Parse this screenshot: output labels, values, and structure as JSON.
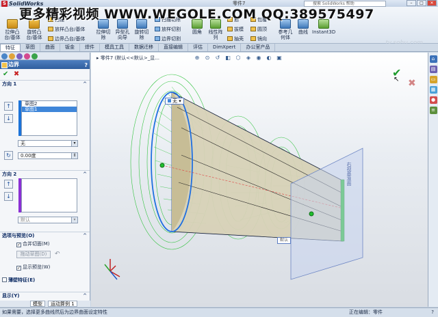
{
  "app": {
    "name": "SolidWorks",
    "document_title": "零件7",
    "search_placeholder": "搜索 SolidWorks 帮助"
  },
  "watermark": {
    "cn": "更多精彩视频",
    "url": "WWW.WEGOLE.COM",
    "qq": "QQ:389575497"
  },
  "corner_mark": "tv.sohu.com",
  "ribbon": {
    "buttons": [
      "拉伸凸台/基体",
      "旋转凸台/基体",
      "拉伸切除",
      "异型孔向导",
      "旋转切除",
      "圆角",
      "线性阵列",
      "拔模",
      "参考几何体",
      "曲线",
      "Instant3D"
    ],
    "small": [
      "扫描",
      "放样凸台/基体",
      "边界凸台/基体",
      "扫描切除",
      "放样切割",
      "边界切割",
      "筋",
      "抽壳",
      "包覆",
      "圆顶",
      "镜向"
    ]
  },
  "tabs": [
    "特征",
    "草图",
    "曲面",
    "钣金",
    "焊件",
    "模具工具",
    "数据迁移",
    "直接编辑",
    "评估",
    "DimXpert",
    "办公室产品"
  ],
  "property_manager": {
    "title": "边界",
    "direction1": {
      "label": "方向 1",
      "items": [
        "草图2",
        "草图1"
      ],
      "tangency": "无",
      "value": "0.00度"
    },
    "direction2": {
      "label": "方向 2",
      "option": "默认"
    },
    "options": {
      "label": "选项与预览(O)",
      "merge": "合并切面(M)",
      "drag_sketch": "拖动草图(D)",
      "show_preview": "显示预览(W)"
    },
    "thin_feature": "薄壁特征(E)",
    "display": "显示(Y)"
  },
  "bottom_tabs": [
    "模型",
    "运动算例 1"
  ],
  "viewport": {
    "tree_path": "零件7 (默认<<默认>_显...",
    "callout_top": "无",
    "callout_bottom": "默认",
    "vertical_label": "右视基准面"
  },
  "status": {
    "hint": "如果需要，选择更多曲线然后为边界曲面设定特性",
    "mode": "正在编辑：零件",
    "help": "?"
  }
}
